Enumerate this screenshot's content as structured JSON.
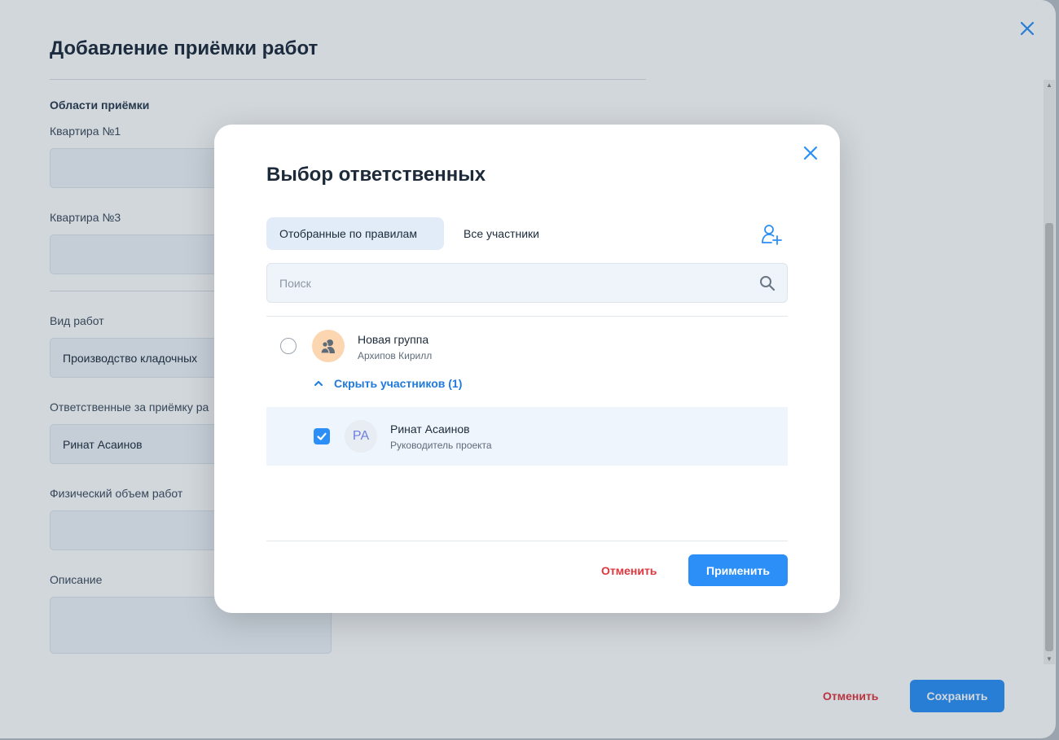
{
  "form": {
    "title": "Добавление приёмки работ",
    "section_title": "Области приёмки",
    "fields": {
      "apartment1_label": "Квартира №1",
      "apartment1_value": "",
      "apartment3_label": "Квартира №3",
      "apartment3_value": "",
      "work_type_label": "Вид работ",
      "work_type_value": "Производство кладочных",
      "responsible_label": "Ответственные за приёмку ра",
      "responsible_value": "Ринат Асаинов",
      "volume_label": "Физический объем работ",
      "volume_value": "",
      "description_label": "Описание",
      "description_value": ""
    },
    "cancel_label": "Отменить",
    "save_label": "Сохранить"
  },
  "modal": {
    "title": "Выбор ответственных",
    "tabs": [
      {
        "label": "Отобранные по правилам",
        "active": true
      },
      {
        "label": "Все участники",
        "active": false
      }
    ],
    "search": {
      "placeholder": "Поиск",
      "value": ""
    },
    "group": {
      "name": "Новая группа",
      "subtitle": "Архипов Кирилл",
      "selected": false,
      "toggle_label": "Скрыть участников (1)"
    },
    "members": [
      {
        "initials": "РА",
        "name": "Ринат Асаинов",
        "role": "Руководитель проекта",
        "checked": true
      }
    ],
    "cancel_label": "Отменить",
    "apply_label": "Применить"
  },
  "icons": {
    "panel_close": "close-icon",
    "modal_close": "close-icon",
    "add_user": "add-user-icon",
    "search": "search-icon",
    "group": "group-icon",
    "toggle": "chevron-up-icon",
    "checkbox": "checkmark-icon"
  },
  "colors": {
    "accent": "#2b8ff7",
    "danger": "#e0363e",
    "link": "#1f7adb",
    "group_avatar_bg": "#fcd6b0",
    "member_avatar_text": "#6c7fe0"
  }
}
